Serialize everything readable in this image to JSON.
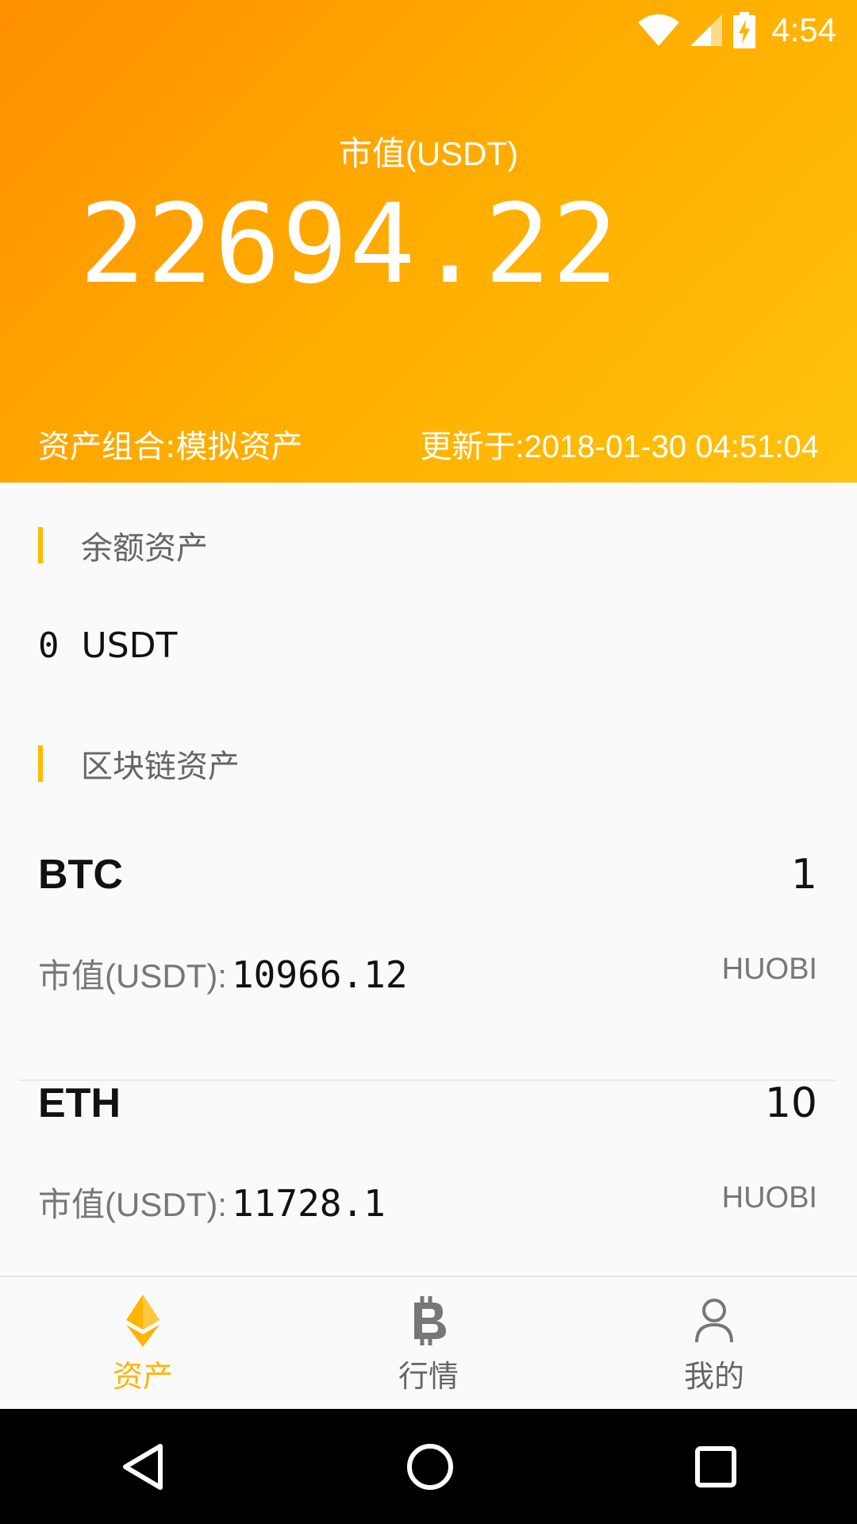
{
  "status_bar": {
    "time": "4:54",
    "icons": [
      "wifi-icon",
      "signal-icon",
      "battery-charging-icon"
    ]
  },
  "header": {
    "market_value_label": "市值(USDT)",
    "market_value": "22694.22",
    "portfolio": "资产组合:模拟资产",
    "updated": "更新于:2018-01-30 04:51:04",
    "colors": {
      "gradient_start": "#ff9000",
      "gradient_end": "#ffc20e"
    }
  },
  "balance_section": {
    "title": "余额资产",
    "amount": "0",
    "currency": "USDT"
  },
  "blockchain_section": {
    "title": "区块链资产",
    "assets": [
      {
        "symbol": "BTC",
        "quantity": "1",
        "mv_label": "市值(USDT):",
        "market_value": "10966.12",
        "exchange": "HUOBI"
      },
      {
        "symbol": "ETH",
        "quantity": "10",
        "mv_label": "市值(USDT):",
        "market_value": "11728.1",
        "exchange": "HUOBI"
      }
    ]
  },
  "tabbar": {
    "tabs": [
      {
        "label": "资产",
        "icon": "ethereum-icon",
        "active": true
      },
      {
        "label": "行情",
        "icon": "bitcoin-icon",
        "active": false
      },
      {
        "label": "我的",
        "icon": "user-icon",
        "active": false
      }
    ],
    "accent_color": "#ffb400"
  },
  "navbar": {
    "buttons": [
      "back-icon",
      "home-icon",
      "recents-icon"
    ]
  }
}
